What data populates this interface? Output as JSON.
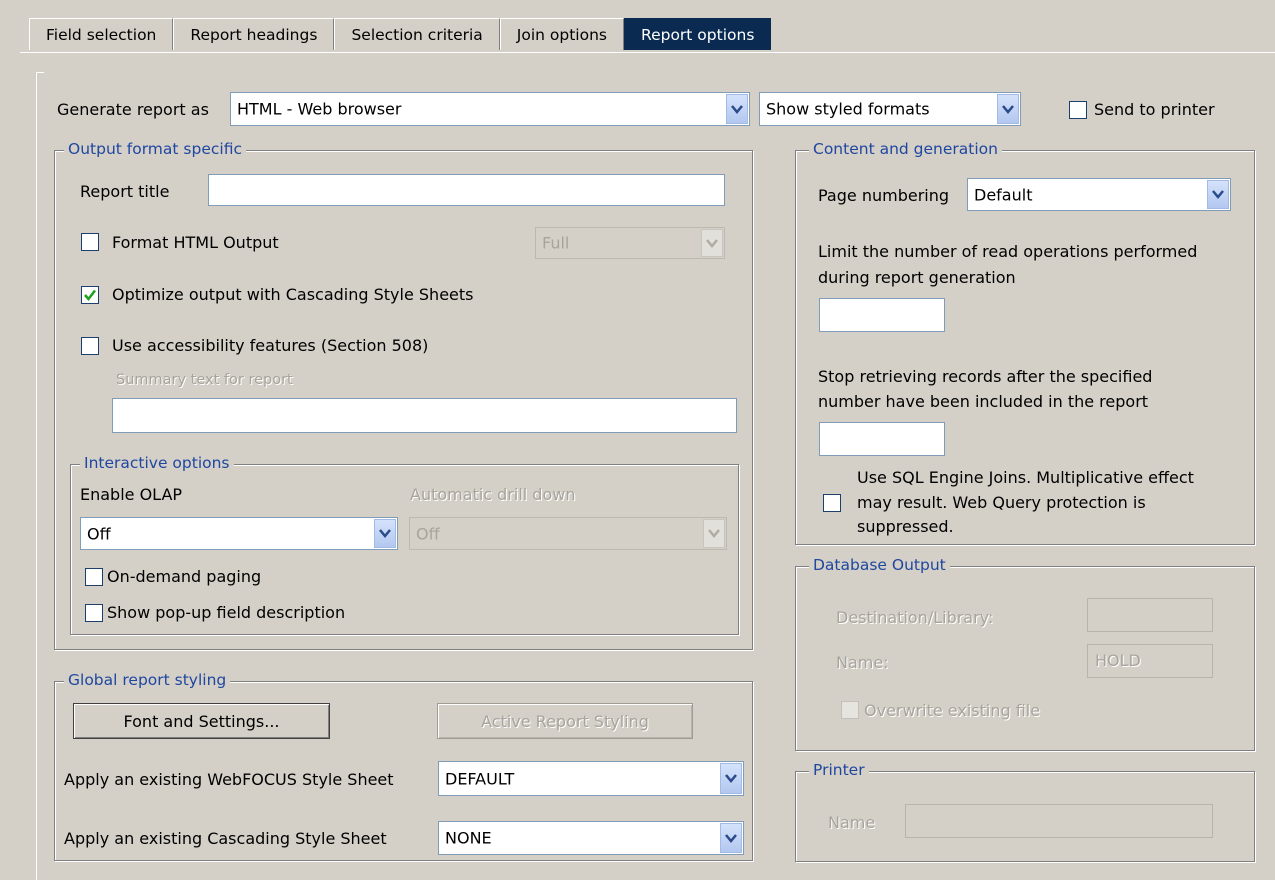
{
  "tabs": [
    {
      "label": "Field selection",
      "active": false
    },
    {
      "label": "Report headings",
      "active": false
    },
    {
      "label": "Selection criteria",
      "active": false
    },
    {
      "label": "Join options",
      "active": false
    },
    {
      "label": "Report options",
      "active": true
    }
  ],
  "top": {
    "generate_label": "Generate report as",
    "generate_value": "HTML - Web browser",
    "styled_value": "Show styled formats",
    "send_to_printer_label": "Send to printer",
    "send_to_printer_checked": false
  },
  "output_format": {
    "legend": "Output format specific",
    "report_title_label": "Report title",
    "report_title_value": "",
    "format_html_label": "Format HTML Output",
    "format_html_checked": false,
    "format_html_select": "Full",
    "optimize_css_label": "Optimize output with Cascading Style Sheets",
    "optimize_css_checked": true,
    "accessibility_label": "Use accessibility features (Section 508)",
    "accessibility_checked": false,
    "summary_label": "Summary text for report",
    "summary_value": ""
  },
  "interactive": {
    "legend": "Interactive options",
    "enable_olap_label": "Enable OLAP",
    "enable_olap_value": "Off",
    "auto_drill_label": "Automatic drill down",
    "auto_drill_value": "Off",
    "on_demand_label": "On-demand paging",
    "popup_label": "Show pop-up field description"
  },
  "global_styling": {
    "legend": "Global report styling",
    "font_button": "Font and Settings...",
    "active_button": "Active Report Styling",
    "webfocus_label": "Apply an existing WebFOCUS Style Sheet",
    "webfocus_value": "DEFAULT",
    "css_label": "Apply an existing Cascading Style Sheet",
    "css_value": "NONE"
  },
  "content": {
    "legend": "Content and generation",
    "page_numbering_label": "Page numbering",
    "page_numbering_value": "Default",
    "limit_reads_line1": "Limit the number of read operations performed",
    "limit_reads_line2": "during report generation",
    "limit_reads_value": "",
    "stop_line1": "Stop retrieving records after the specified",
    "stop_line2": "number have been included in the report",
    "stop_value": "",
    "sql_line1": "Use SQL Engine Joins. Multiplicative effect",
    "sql_line2": "may result. Web Query protection is",
    "sql_line3": "suppressed.",
    "sql_checked": false
  },
  "database_output": {
    "legend": "Database Output",
    "destination_label": "Destination/Library:",
    "destination_value": "",
    "name_label": "Name:",
    "name_value": "HOLD",
    "overwrite_label": "Overwrite existing file"
  },
  "printer": {
    "legend": "Printer",
    "name_label": "Name",
    "name_value": ""
  },
  "colors": {
    "background": "#d4d0c8",
    "active_tab": "#0a2a52",
    "legend_text": "#1f47a0",
    "checkmark": "#21a121"
  }
}
